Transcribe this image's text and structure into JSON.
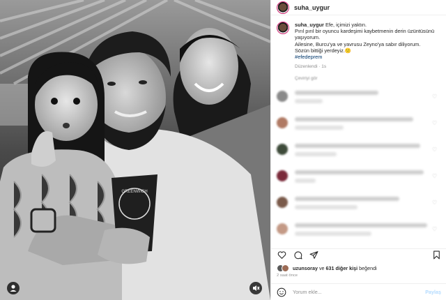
{
  "post": {
    "username": "suha_uygur",
    "caption_lines": [
      "Efe, içimizi yaktın.",
      "Pırıl pırıl bir oyuncu kardeşimi kaybetmenin derin üzüntüsünü yaşıyorum.",
      "Ailesine, Burcu'ya ve yavrusu Zeyno'ya sabır diliyorum.",
      "Sözün bittiği yerdeyiz."
    ],
    "caption_emoji": "🙁",
    "hashtag": "#efedeprem",
    "edited": "Düzenlendi · 1s",
    "translate": "Çeviriyi gör",
    "cup_text": "GREENWICH"
  },
  "likes": {
    "user": "uzunsoray",
    "connector": "ve",
    "others": "631 diğer kişi",
    "suffix": "beğendi"
  },
  "time_ago": "2 saat önce",
  "comment_box": {
    "placeholder": "Yorum ekle...",
    "post_label": "Paylaş"
  },
  "icons": {
    "like": "heart-icon",
    "comment": "comment-icon",
    "share": "share-icon",
    "save": "bookmark-icon",
    "emoji": "smiley-icon",
    "user_tag": "user-tag-icon",
    "mute": "mute-icon"
  },
  "colors": {
    "link": "#00376b",
    "post_button": "#b3dbff",
    "secondary_text": "#8e8e8e"
  }
}
